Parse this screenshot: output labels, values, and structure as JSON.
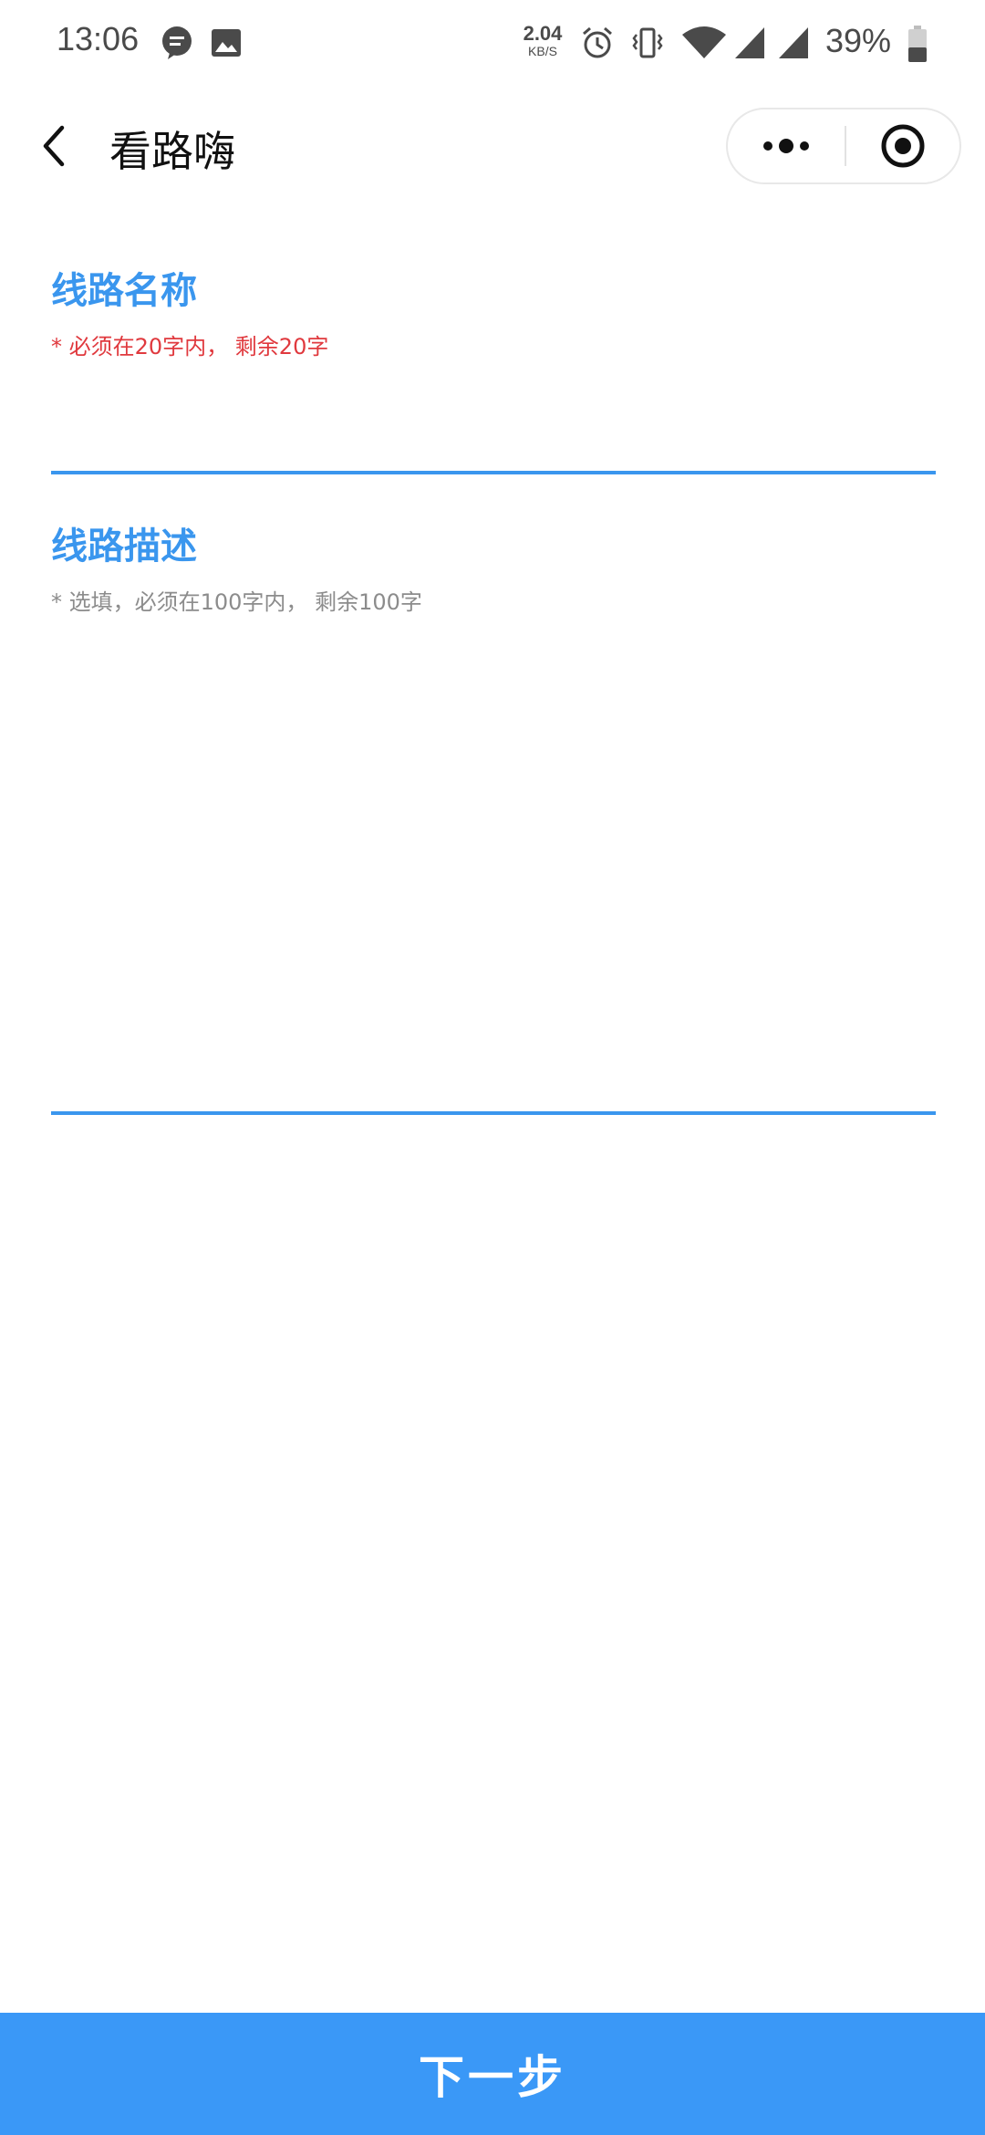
{
  "status_bar": {
    "time": "13:06",
    "net_speed_value": "2.04",
    "net_speed_unit": "KB/S",
    "battery_percent": "39%",
    "icons": [
      "message-icon",
      "image-icon",
      "alarm-icon",
      "vibrate-icon",
      "wifi-icon",
      "signal-icon",
      "signal-icon",
      "battery-icon"
    ]
  },
  "nav": {
    "title": "看路嗨",
    "back_icon": "chevron-left-icon",
    "more_icon": "more-dots-icon",
    "close_icon": "target-circle-icon"
  },
  "form": {
    "route_name": {
      "label": "线路名称",
      "hint": "* 必须在20字内， 剩余20字",
      "value": ""
    },
    "route_description": {
      "label": "线路描述",
      "hint": "* 选填，必须在100字内， 剩余100字",
      "value": ""
    }
  },
  "footer": {
    "next_label": "下一步"
  },
  "colors": {
    "accent": "#3a96ee",
    "button_bg": "#3a98f7",
    "required_hint": "#e0393e",
    "optional_hint": "#8c8c8c"
  }
}
